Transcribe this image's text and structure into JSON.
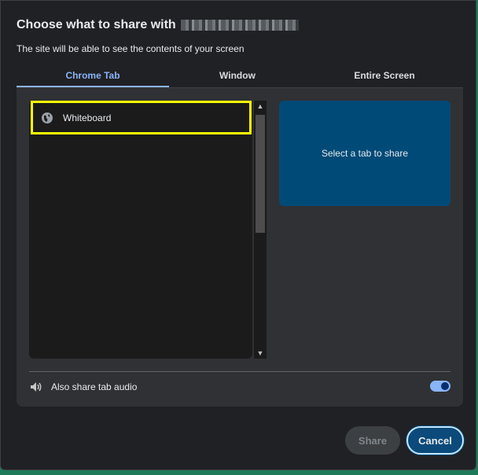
{
  "dialog": {
    "title": "Choose what to share with",
    "subtitle": "The site will be able to see the contents of your screen"
  },
  "tabs": [
    {
      "label": "Chrome Tab",
      "selected": true
    },
    {
      "label": "Window",
      "selected": false
    },
    {
      "label": "Entire Screen",
      "selected": false
    }
  ],
  "list": {
    "items": [
      {
        "label": "Whiteboard",
        "icon": "globe-icon",
        "highlighted": true
      }
    ]
  },
  "preview": {
    "text": "Select a tab to share"
  },
  "audio": {
    "label": "Also share tab audio",
    "enabled": true
  },
  "buttons": {
    "share": "Share",
    "cancel": "Cancel"
  },
  "colors": {
    "accent": "#8ab4f8",
    "preview_bg": "#004a77",
    "highlight": "#ffff00",
    "background": "#202124"
  }
}
